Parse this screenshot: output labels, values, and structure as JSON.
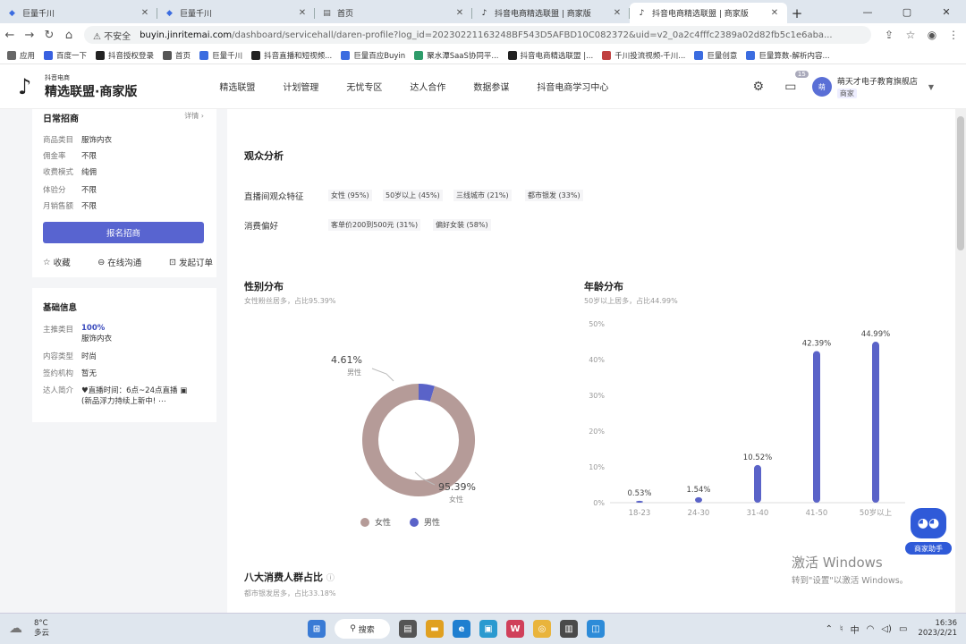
{
  "browser": {
    "tabs": [
      {
        "title": "巨量千川",
        "icon": "juliang-icon",
        "color": "#3b6ce0"
      },
      {
        "title": "巨量千川",
        "icon": "juliang-icon",
        "color": "#3b6ce0"
      },
      {
        "title": "首页",
        "icon": "doc-icon",
        "color": "#555"
      },
      {
        "title": "抖音电商精选联盟 | 商家版",
        "icon": "douyin-icon",
        "color": "#222"
      },
      {
        "title": "抖音电商精选联盟 | 商家版",
        "icon": "douyin-icon",
        "color": "#222"
      }
    ],
    "address": {
      "security": "不安全",
      "host": "buyin.jinritemai.com",
      "path": "/dashboard/servicehall/daren-profile?log_id=20230221163248BF543D5AFBD10C082372&uid=v2_0a2c4fffc2389a02d82fb5c1e6aba..."
    },
    "bookmarks": [
      {
        "label": "应用",
        "color": "#666"
      },
      {
        "label": "百度一下",
        "color": "#3860e0"
      },
      {
        "label": "抖音授权登录",
        "color": "#222"
      },
      {
        "label": "首页",
        "color": "#555"
      },
      {
        "label": "巨量千川",
        "color": "#3b6ce0"
      },
      {
        "label": "抖音直播和短视频...",
        "color": "#222"
      },
      {
        "label": "巨量百应Buyin",
        "color": "#3b6ce0"
      },
      {
        "label": "聚水潭SaaS协同平...",
        "color": "#2e9c6a"
      },
      {
        "label": "抖音电商精选联盟 |...",
        "color": "#222"
      },
      {
        "label": "千川投流视频-千川...",
        "color": "#c04040"
      },
      {
        "label": "巨量创意",
        "color": "#3b6ce0"
      },
      {
        "label": "巨量算数-解析内容...",
        "color": "#3b6ce0"
      }
    ]
  },
  "header": {
    "logo_top": "抖音电商",
    "logo_bottom": "精选联盟·商家版",
    "nav": [
      "精选联盟",
      "计划管理",
      "无忧专区",
      "达人合作",
      "数据参谋",
      "抖音电商学习中心"
    ],
    "message_count": "15",
    "shop_name": "萌天才电子教育旗舰店",
    "shop_tag": "商家"
  },
  "sidebar": {
    "card_title": "日常招商",
    "more": "详情",
    "fields": [
      {
        "k": "商品类目",
        "v": "服饰内衣"
      },
      {
        "k": "佣金率",
        "v": "不限"
      },
      {
        "k": "收费模式",
        "v": "纯佣"
      },
      {
        "k": "体验分",
        "v": "不限"
      },
      {
        "k": "月销售额",
        "v": "不限"
      }
    ],
    "cta": "报名招商",
    "actions": [
      "收藏",
      "在线沟通",
      "发起订单"
    ],
    "basic_title": "基础信息",
    "main_category_label": "主推类目",
    "main_category_pct": "100%",
    "main_category": "服饰内衣",
    "content_type_label": "内容类型",
    "content_type": "时尚",
    "agency_label": "签约机构",
    "agency": "暂无",
    "intro_label": "达人简介",
    "intro_line1": "直播时间：6点~24点直播",
    "intro_line2": "(新品浮力持续上新中!"
  },
  "audience": {
    "title": "观众分析",
    "feature_label": "直播间观众特征",
    "features": [
      "女性 (95%)",
      "50岁以上 (45%)",
      "三线城市 (21%)",
      "都市银发 (33%)"
    ],
    "pref_label": "消费偏好",
    "prefs": [
      "客单价200到500元 (31%)",
      "偏好女装 (58%)"
    ]
  },
  "gender": {
    "title": "性别分布",
    "subtitle": "女性粉丝居多，占比95.39%",
    "female_label": "女性",
    "male_label": "男性",
    "female_pct": "95.39%",
    "male_pct": "4.61%"
  },
  "age": {
    "title": "年龄分布",
    "subtitle": "50岁以上居多，占比44.99%"
  },
  "eight": {
    "title": "八大消费人群占比",
    "subtitle": "都市银发居多，占比33.18%"
  },
  "helper": {
    "label": "商家助手"
  },
  "watermark": {
    "line1": "激活 Windows",
    "line2": "转到\"设置\"以激活 Windows。"
  },
  "taskbar": {
    "temp": "8°C",
    "weather": "多云",
    "search": "搜索",
    "time": "16:36",
    "date": "2023/2/21",
    "ime": "中"
  },
  "chart_data": [
    {
      "type": "pie",
      "title": "性别分布",
      "categories": [
        "女性",
        "男性"
      ],
      "values": [
        95.39,
        4.61
      ],
      "colors": [
        "#b59b98",
        "#5a63c8"
      ]
    },
    {
      "type": "bar",
      "title": "年龄分布",
      "categories": [
        "18-23",
        "24-30",
        "31-40",
        "41-50",
        "50岁以上"
      ],
      "values": [
        0.53,
        1.54,
        10.52,
        42.39,
        44.99
      ],
      "value_labels": [
        "0.53%",
        "1.54%",
        "10.52%",
        "42.39%",
        "44.99%"
      ],
      "yticks": [
        "0%",
        "10%",
        "20%",
        "30%",
        "40%",
        "50%"
      ],
      "ylim": [
        0,
        50
      ],
      "color": "#5a63c8"
    }
  ]
}
